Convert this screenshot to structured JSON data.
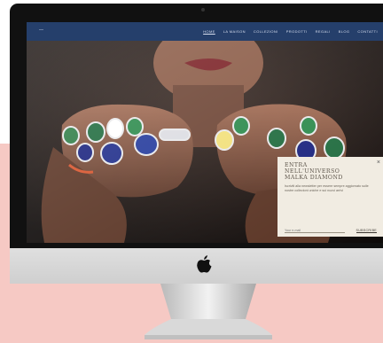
{
  "nav": {
    "logo": "—",
    "items": [
      {
        "label": "HOME",
        "active": true
      },
      {
        "label": "LA MAISON",
        "active": false
      },
      {
        "label": "COLLEZIONI",
        "active": false
      },
      {
        "label": "PRODOTTI",
        "active": false
      },
      {
        "label": "REGALI",
        "active": false
      },
      {
        "label": "BLOG",
        "active": false
      },
      {
        "label": "CONTATTI",
        "active": false
      }
    ]
  },
  "popup": {
    "close": "×",
    "title_line1": "ENTRA",
    "title_line2": "NELL'UNIVERSO",
    "title_line3": "MALKA DIAMOND",
    "text": "Iscriviti alla newsletter per essere sempre aggiornato sulle nostre collezioni uniche e sui nuovi arrivi",
    "email_placeholder": "Your e-mail",
    "subscribe_label": "SUBSCRIBE"
  },
  "colors": {
    "navbar": "#253f6b",
    "background_pink": "#f6c9c4",
    "popup_bg": "#f1ece2"
  },
  "icons": {
    "apple": "apple-logo-icon",
    "close": "close-icon"
  }
}
